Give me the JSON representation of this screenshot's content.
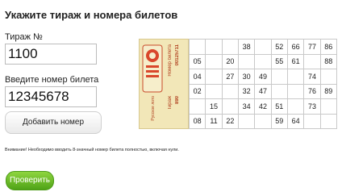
{
  "heading": "Укажите тираж и номера билетов",
  "draw": {
    "label": "Тираж №",
    "value": "1100"
  },
  "ticket_input": {
    "label": "Введите номер билета",
    "value": "12345678"
  },
  "add_button": "Добавить номер",
  "note": "Внимание! Необходимо вводить 8-значный номер билета полностью, включая нули.",
  "check_button": "Проверить",
  "ticket_preview": {
    "stub_brand": "Русское лото",
    "stub_text": "Номер билета",
    "stub_number": "00125711",
    "stub_draw_label": "Тираж",
    "stub_draw": "890",
    "rows": [
      [
        "",
        "",
        "",
        "38",
        "",
        "52",
        "66",
        "77",
        "86"
      ],
      [
        "05",
        "",
        "20",
        "",
        "",
        "55",
        "61",
        "",
        "88"
      ],
      [
        "04",
        "",
        "27",
        "30",
        "49",
        "",
        "",
        "74",
        ""
      ],
      [
        "02",
        "",
        "",
        "32",
        "47",
        "",
        "",
        "76",
        "89"
      ],
      [
        "",
        "15",
        "",
        "34",
        "42",
        "51",
        "",
        "73",
        ""
      ],
      [
        "08",
        "11",
        "22",
        "",
        "",
        "59",
        "64",
        "",
        ""
      ]
    ]
  }
}
